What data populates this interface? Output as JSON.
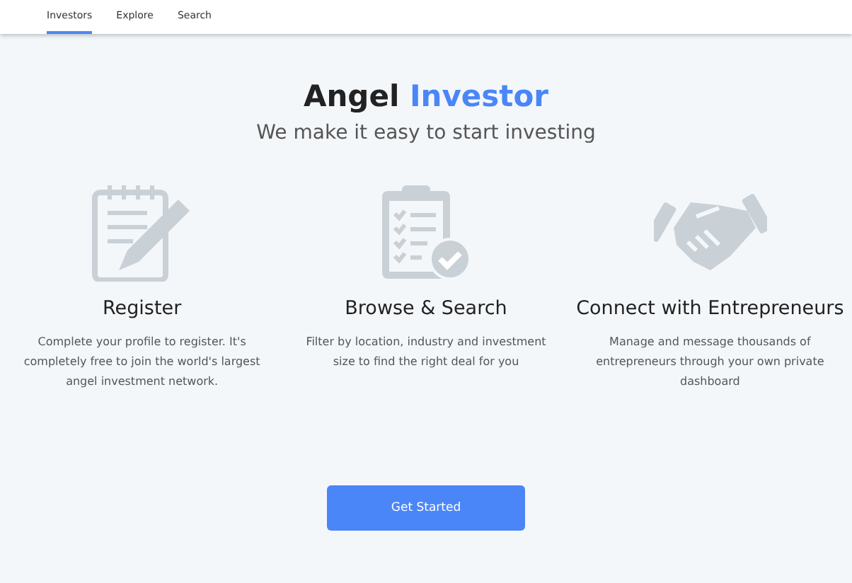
{
  "nav": {
    "tabs": [
      {
        "label": "Investors",
        "selected": true
      },
      {
        "label": "Explore",
        "selected": false
      },
      {
        "label": "Search",
        "selected": false
      }
    ]
  },
  "hero": {
    "title": "Angel",
    "title_highlight": "Investor",
    "subtitle": "We make it easy to start investing"
  },
  "features": [
    {
      "kind": "register",
      "title": "Register",
      "description": "Complete your profile to register. It's completely free to join the world's largest angel investment network."
    },
    {
      "kind": "browse",
      "title": "Browse & Search",
      "description": "Filter by location, industry and investment size to find the right deal for you"
    },
    {
      "kind": "connect",
      "title": "Connect with Entrepreneurs",
      "description": "Manage and message thousands of entrepreneurs through your own private dashboard"
    }
  ],
  "cta": {
    "label": "Get Started"
  }
}
